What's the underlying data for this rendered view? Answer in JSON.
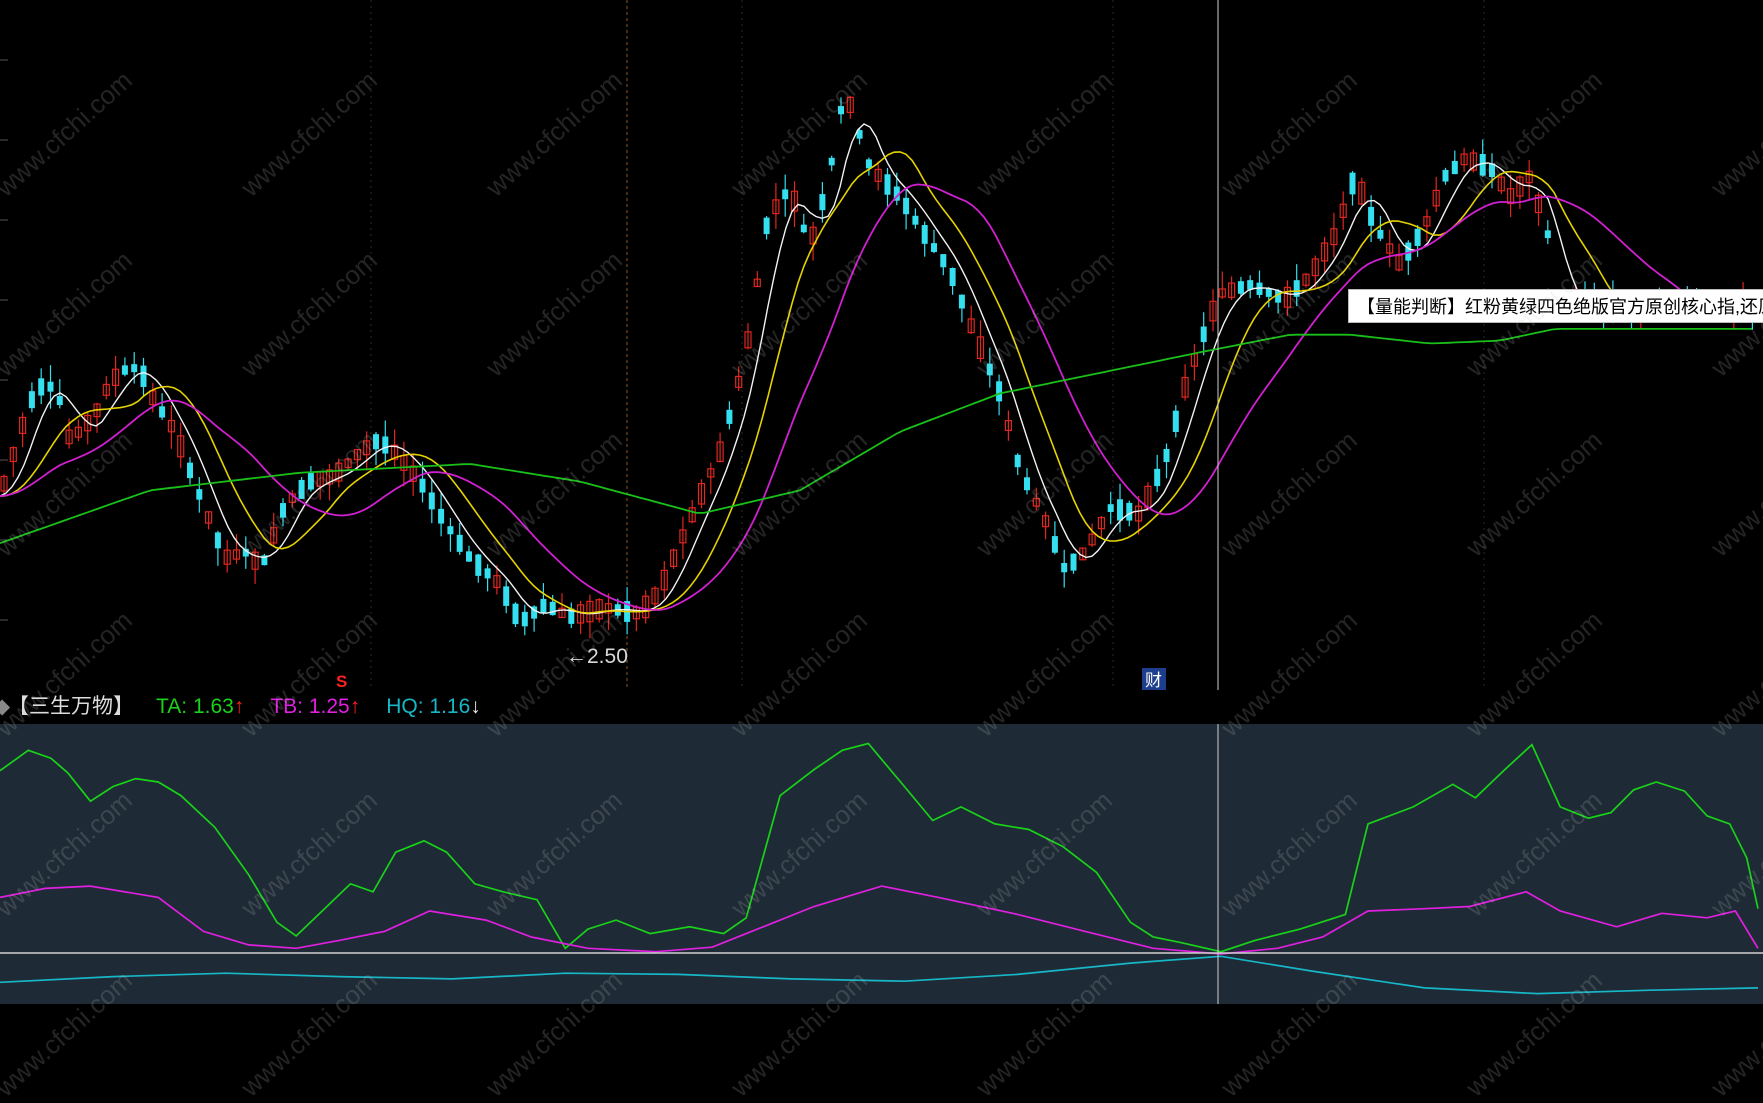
{
  "legend": {
    "indicator_name": "【三生万物】",
    "ta_label": "TA: 1.63",
    "ta_arrow": "↑",
    "tb_label": "TB: 1.25",
    "tb_arrow": "↑",
    "hq_label": "HQ: 1.16",
    "hq_arrow": "↓"
  },
  "tooltip": {
    "text": "【量能判断】红粉黄绿四色绝版官方原创核心指,还原"
  },
  "markers": {
    "low_price_label": "←2.50",
    "sell_signal": "S",
    "finance_badge": "财"
  },
  "watermark": "www.cfchi.com",
  "colors": {
    "up_candle": "#e0261e",
    "down_candle": "#34e0f0",
    "neutral_candle": "#ffffff",
    "ma_white": "#f2f2f2",
    "ma_yellow": "#e6d200",
    "ma_magenta": "#d020d0",
    "ma_green": "#19c019",
    "ta": "#19d219",
    "tb": "#e020e0",
    "hq": "#17b7c8"
  },
  "chart_data": [
    {
      "type": "candlestick",
      "title": "",
      "xlabel": "",
      "ylabel": "",
      "min_price_marker": 2.5,
      "ylim": [
        2.37,
        4.72
      ],
      "anchors": [
        [
          0,
          3.03
        ],
        [
          30,
          3.35
        ],
        [
          45,
          3.42
        ],
        [
          58,
          3.38
        ],
        [
          70,
          3.22
        ],
        [
          82,
          3.26
        ],
        [
          94,
          3.3
        ],
        [
          110,
          3.42
        ],
        [
          125,
          3.46
        ],
        [
          140,
          3.47
        ],
        [
          150,
          3.38
        ],
        [
          175,
          3.25
        ],
        [
          200,
          3.03
        ],
        [
          225,
          2.82
        ],
        [
          245,
          2.84
        ],
        [
          262,
          2.79
        ],
        [
          285,
          3.0
        ],
        [
          310,
          3.08
        ],
        [
          335,
          3.1
        ],
        [
          360,
          3.18
        ],
        [
          378,
          3.22
        ],
        [
          392,
          3.19
        ],
        [
          420,
          3.08
        ],
        [
          445,
          2.94
        ],
        [
          470,
          2.82
        ],
        [
          500,
          2.73
        ],
        [
          520,
          2.6
        ],
        [
          545,
          2.66
        ],
        [
          570,
          2.62
        ],
        [
          605,
          2.65
        ],
        [
          640,
          2.63
        ],
        [
          660,
          2.71
        ],
        [
          690,
          2.95
        ],
        [
          720,
          3.18
        ],
        [
          745,
          3.5
        ],
        [
          768,
          3.98
        ],
        [
          790,
          4.08
        ],
        [
          810,
          3.88
        ],
        [
          828,
          4.1
        ],
        [
          845,
          4.42
        ],
        [
          870,
          4.15
        ],
        [
          900,
          4.05
        ],
        [
          925,
          3.92
        ],
        [
          950,
          3.8
        ],
        [
          970,
          3.62
        ],
        [
          1000,
          3.38
        ],
        [
          1020,
          3.12
        ],
        [
          1045,
          2.95
        ],
        [
          1065,
          2.78
        ],
        [
          1085,
          2.84
        ],
        [
          1110,
          2.99
        ],
        [
          1140,
          2.97
        ],
        [
          1165,
          3.15
        ],
        [
          1185,
          3.4
        ],
        [
          1200,
          3.55
        ],
        [
          1220,
          3.72
        ],
        [
          1250,
          3.75
        ],
        [
          1285,
          3.7
        ],
        [
          1310,
          3.78
        ],
        [
          1335,
          3.92
        ],
        [
          1355,
          4.12
        ],
        [
          1375,
          3.95
        ],
        [
          1400,
          3.82
        ],
        [
          1425,
          3.95
        ],
        [
          1445,
          4.12
        ],
        [
          1465,
          4.18
        ],
        [
          1490,
          4.15
        ],
        [
          1510,
          4.05
        ],
        [
          1530,
          4.12
        ],
        [
          1548,
          3.92
        ],
        [
          1555,
          3.68
        ]
      ],
      "ma_green_curve": [
        [
          0,
          2.87
        ],
        [
          150,
          3.05
        ],
        [
          300,
          3.11
        ],
        [
          470,
          3.14
        ],
        [
          580,
          3.08
        ],
        [
          700,
          2.97
        ],
        [
          800,
          3.05
        ],
        [
          900,
          3.25
        ],
        [
          1000,
          3.38
        ],
        [
          1100,
          3.45
        ],
        [
          1200,
          3.52
        ],
        [
          1290,
          3.58
        ],
        [
          1350,
          3.58
        ],
        [
          1430,
          3.55
        ],
        [
          1500,
          3.56
        ],
        [
          1555,
          3.6
        ]
      ]
    },
    {
      "type": "line",
      "title": "",
      "xlabel": "",
      "ylabel": "",
      "ylim": [
        0,
        1.9
      ],
      "series": [
        {
          "name": "TA",
          "values": [
            [
              0,
              1.62
            ],
            [
              25,
              1.8
            ],
            [
              45,
              1.73
            ],
            [
              60,
              1.6
            ],
            [
              80,
              1.35
            ],
            [
              100,
              1.48
            ],
            [
              120,
              1.55
            ],
            [
              140,
              1.52
            ],
            [
              160,
              1.4
            ],
            [
              190,
              1.12
            ],
            [
              220,
              0.7
            ],
            [
              245,
              0.28
            ],
            [
              262,
              0.16
            ],
            [
              285,
              0.38
            ],
            [
              310,
              0.62
            ],
            [
              330,
              0.55
            ],
            [
              350,
              0.9
            ],
            [
              375,
              1.0
            ],
            [
              395,
              0.9
            ],
            [
              420,
              0.62
            ],
            [
              445,
              0.55
            ],
            [
              475,
              0.48
            ],
            [
              500,
              0.05
            ],
            [
              520,
              0.22
            ],
            [
              545,
              0.3
            ],
            [
              575,
              0.18
            ],
            [
              610,
              0.24
            ],
            [
              640,
              0.18
            ],
            [
              660,
              0.32
            ],
            [
              690,
              1.4
            ],
            [
              720,
              1.63
            ],
            [
              745,
              1.8
            ],
            [
              768,
              1.86
            ],
            [
              800,
              1.48
            ],
            [
              825,
              1.18
            ],
            [
              850,
              1.3
            ],
            [
              880,
              1.15
            ],
            [
              910,
              1.1
            ],
            [
              940,
              0.95
            ],
            [
              970,
              0.72
            ],
            [
              1000,
              0.28
            ],
            [
              1020,
              0.15
            ],
            [
              1045,
              0.1
            ],
            [
              1080,
              0.02
            ],
            [
              1110,
              0.12
            ],
            [
              1150,
              0.22
            ],
            [
              1190,
              0.35
            ],
            [
              1210,
              1.15
            ],
            [
              1250,
              1.3
            ],
            [
              1285,
              1.5
            ],
            [
              1305,
              1.38
            ],
            [
              1330,
              1.62
            ],
            [
              1355,
              1.85
            ],
            [
              1380,
              1.3
            ],
            [
              1405,
              1.2
            ],
            [
              1425,
              1.25
            ],
            [
              1445,
              1.45
            ],
            [
              1465,
              1.52
            ],
            [
              1490,
              1.44
            ],
            [
              1510,
              1.22
            ],
            [
              1530,
              1.15
            ],
            [
              1545,
              0.85
            ],
            [
              1555,
              0.4
            ]
          ]
        },
        {
          "name": "TB",
          "values": [
            [
              0,
              0.5
            ],
            [
              40,
              0.58
            ],
            [
              80,
              0.6
            ],
            [
              140,
              0.5
            ],
            [
              180,
              0.2
            ],
            [
              220,
              0.08
            ],
            [
              262,
              0.05
            ],
            [
              300,
              0.12
            ],
            [
              340,
              0.2
            ],
            [
              380,
              0.38
            ],
            [
              430,
              0.3
            ],
            [
              470,
              0.15
            ],
            [
              520,
              0.05
            ],
            [
              580,
              0.02
            ],
            [
              630,
              0.06
            ],
            [
              660,
              0.18
            ],
            [
              720,
              0.42
            ],
            [
              780,
              0.6
            ],
            [
              830,
              0.5
            ],
            [
              900,
              0.35
            ],
            [
              960,
              0.2
            ],
            [
              1020,
              0.05
            ],
            [
              1080,
              0.0
            ],
            [
              1130,
              0.05
            ],
            [
              1170,
              0.15
            ],
            [
              1210,
              0.38
            ],
            [
              1260,
              0.4
            ],
            [
              1300,
              0.42
            ],
            [
              1350,
              0.55
            ],
            [
              1380,
              0.38
            ],
            [
              1430,
              0.24
            ],
            [
              1470,
              0.36
            ],
            [
              1510,
              0.32
            ],
            [
              1535,
              0.38
            ],
            [
              1555,
              0.05
            ]
          ]
        },
        {
          "name": "HQ",
          "values": [
            [
              0,
              -0.25
            ],
            [
              100,
              -0.2
            ],
            [
              200,
              -0.17
            ],
            [
              300,
              -0.2
            ],
            [
              400,
              -0.22
            ],
            [
              500,
              -0.17
            ],
            [
              600,
              -0.18
            ],
            [
              700,
              -0.22
            ],
            [
              800,
              -0.24
            ],
            [
              900,
              -0.18
            ],
            [
              1000,
              -0.08
            ],
            [
              1080,
              -0.02
            ],
            [
              1160,
              -0.15
            ],
            [
              1260,
              -0.3
            ],
            [
              1360,
              -0.35
            ],
            [
              1460,
              -0.32
            ],
            [
              1555,
              -0.3
            ]
          ]
        }
      ]
    }
  ]
}
